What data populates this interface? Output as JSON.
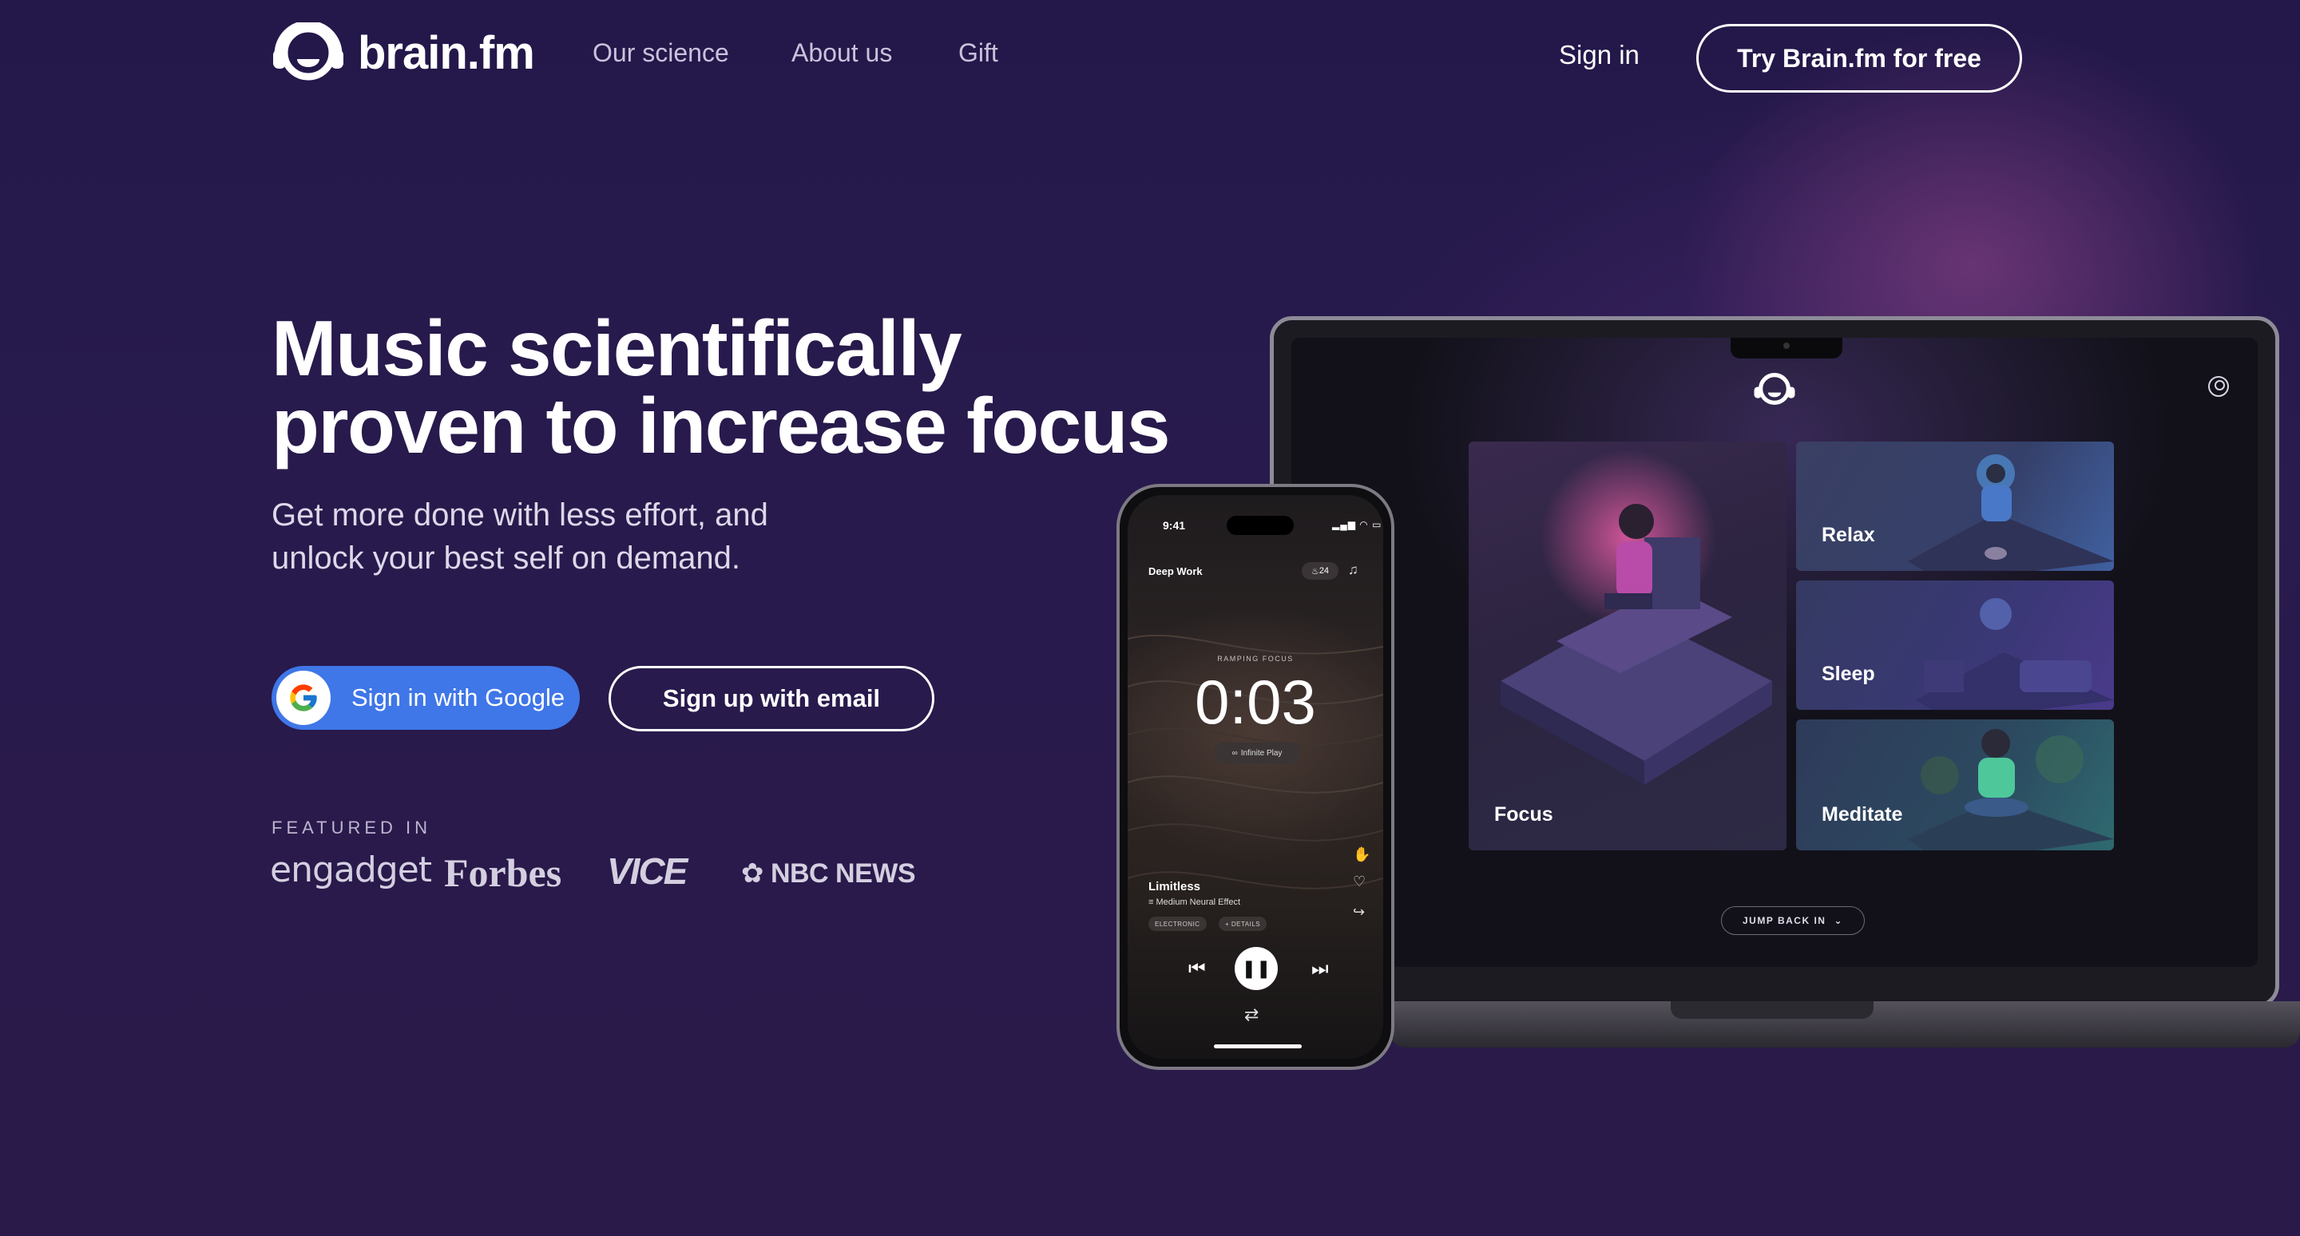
{
  "nav": {
    "logo_text": "brain.fm",
    "links": [
      "Our science",
      "About us",
      "Gift"
    ],
    "sign_in": "Sign in",
    "cta": "Try Brain.fm for free"
  },
  "hero": {
    "headline_line1": "Music scientifically",
    "headline_line2": "proven to increase focus",
    "sub_line1": "Get more done with less effort, and",
    "sub_line2": "unlock your best self on demand.",
    "google_button": "Sign in with Google",
    "email_button": "Sign up with email"
  },
  "press": {
    "heading": "FEATURED IN",
    "logos": [
      "engadget",
      "Forbes",
      "VICE",
      "NBC NEWS"
    ]
  },
  "laptop": {
    "tiles": [
      "Focus",
      "Relax",
      "Sleep",
      "Meditate"
    ],
    "jump_back": "JUMP BACK IN"
  },
  "phone": {
    "time": "9:41",
    "mode": "Deep Work",
    "streak": "24",
    "ramp_label": "RAMPING FOCUS",
    "timer": "0:03",
    "infinite": "Infinite Play",
    "track": "Limitless",
    "effect": "Medium Neural Effect",
    "genre_tag": "ELECTRONIC",
    "details_tag": "+ DETAILS"
  },
  "colors": {
    "background": "#271a4b",
    "google_blue": "#3f76e8",
    "text": "#ffffff"
  }
}
